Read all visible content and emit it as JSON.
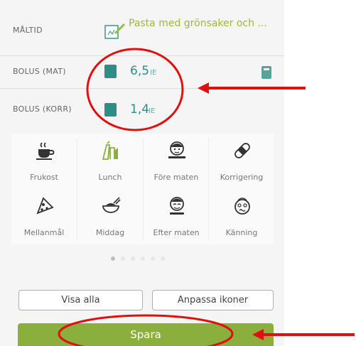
{
  "meal": {
    "label": "MÅLTID",
    "name": "Pasta med grönsaker och ..."
  },
  "bolus_food": {
    "label": "BOLUS (MAT)",
    "value": "6,5",
    "unit": "IE"
  },
  "bolus_corr": {
    "label": "BOLUS (KORR)",
    "value": "1,4",
    "unit": "IE"
  },
  "categories": [
    {
      "label": "Frukost",
      "icon": "coffee-cup-icon"
    },
    {
      "label": "Lunch",
      "icon": "lunch-icon"
    },
    {
      "label": "Före maten",
      "icon": "before-meal-face-icon"
    },
    {
      "label": "Korrigering",
      "icon": "bandage-icon"
    },
    {
      "label": "Mellanmål",
      "icon": "pizza-slice-icon"
    },
    {
      "label": "Middag",
      "icon": "dinner-bowl-icon"
    },
    {
      "label": "Efter maten",
      "icon": "after-meal-face-icon"
    },
    {
      "label": "Känning",
      "icon": "dizzy-face-icon"
    }
  ],
  "pagination": {
    "pages": 6,
    "active": 1
  },
  "buttons": {
    "show_all": "Visa alla",
    "customize": "Anpassa ikoner",
    "save": "Spara"
  },
  "colors": {
    "accent_green": "#8aaf3d",
    "teal": "#2e8e85",
    "annotation_red": "#e01010"
  }
}
